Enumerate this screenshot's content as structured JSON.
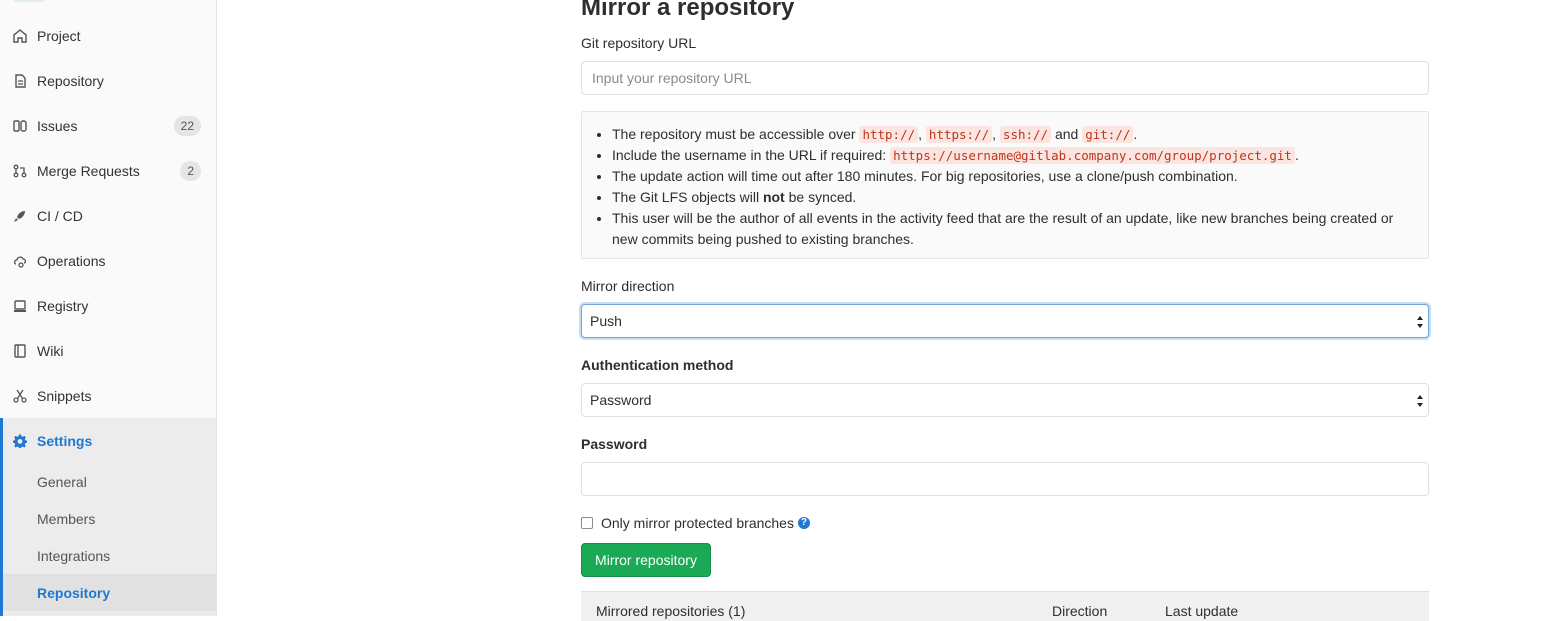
{
  "sidebar": {
    "items": [
      {
        "label": "Project",
        "icon": "home-icon"
      },
      {
        "label": "Repository",
        "icon": "doc-icon"
      },
      {
        "label": "Issues",
        "icon": "issues-icon",
        "badge": "22"
      },
      {
        "label": "Merge Requests",
        "icon": "merge-icon",
        "badge": "2"
      },
      {
        "label": "CI / CD",
        "icon": "rocket-icon"
      },
      {
        "label": "Operations",
        "icon": "cloud-gear-icon"
      },
      {
        "label": "Registry",
        "icon": "disk-icon"
      },
      {
        "label": "Wiki",
        "icon": "book-icon"
      },
      {
        "label": "Snippets",
        "icon": "scissors-icon"
      },
      {
        "label": "Settings",
        "icon": "gear-icon"
      }
    ],
    "sub_items": [
      "General",
      "Members",
      "Integrations",
      "Repository"
    ]
  },
  "main": {
    "title": "Mirror a repository",
    "url_label": "Git repository URL",
    "url_placeholder": "Input your repository URL",
    "info": {
      "line1_pre": "The repository must be accessible over",
      "codes": [
        "http://",
        "https://",
        "ssh://",
        "git://"
      ],
      "and": "and",
      "line2_pre": "Include the username in the URL if required:",
      "line2_code": "https://username@gitlab.company.com/group/project.git",
      "line3": "The update action will time out after 180 minutes. For big repositories, use a clone/push combination.",
      "line4_pre": "The Git LFS objects will",
      "line4_bold": "not",
      "line4_post": "be synced.",
      "line5": "This user will be the author of all events in the activity feed that are the result of an update, like new branches being created or new commits being pushed to existing branches."
    },
    "direction_label": "Mirror direction",
    "direction_value": "Push",
    "auth_label": "Authentication method",
    "auth_value": "Password",
    "password_label": "Password",
    "protected_label": "Only mirror protected branches",
    "submit_label": "Mirror repository",
    "table": {
      "col1": "Mirrored repositories (1)",
      "col2": "Direction",
      "col3": "Last update"
    }
  },
  "colors": {
    "accent": "#1f78d1",
    "success": "#1aaa55",
    "code_text": "#c0341d"
  }
}
